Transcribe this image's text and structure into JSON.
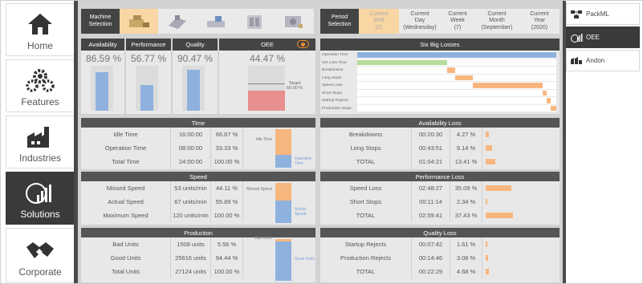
{
  "left_nav": [
    {
      "label": "Home",
      "icon": "home-icon"
    },
    {
      "label": "Features",
      "icon": "gears-icon"
    },
    {
      "label": "Industries",
      "icon": "factory-icon"
    },
    {
      "label": "Solutions",
      "icon": "solutions-icon"
    },
    {
      "label": "Corporate",
      "icon": "handshake-icon"
    }
  ],
  "right_nav": [
    {
      "label": "PackML",
      "icon": "packml-icon"
    },
    {
      "label": "OEE",
      "icon": "oee-icon"
    },
    {
      "label": "Andon",
      "icon": "andon-icon"
    }
  ],
  "machine_selection": {
    "label": "Machine Selection",
    "machines": [
      "machine-1-icon",
      "machine-2-icon",
      "machine-3-icon",
      "machine-4-icon",
      "machine-5-icon",
      "machine-6-icon"
    ]
  },
  "period_selection": {
    "label": "Period Selection",
    "periods": [
      {
        "line1": "Current",
        "line2": "Shift",
        "line3": "(2)"
      },
      {
        "line1": "Current",
        "line2": "Day",
        "line3": "(Wednesday)"
      },
      {
        "line1": "Current",
        "line2": "Week",
        "line3": "(7)"
      },
      {
        "line1": "Current",
        "line2": "Month",
        "line3": "(September)"
      },
      {
        "line1": "Current",
        "line2": "Year",
        "line3": "(2020)"
      }
    ]
  },
  "kpis": [
    {
      "label": "Availability",
      "value": "86.59 %",
      "level": 0.8659
    },
    {
      "label": "Performance",
      "value": "56.77 %",
      "level": 0.5677
    },
    {
      "label": "Quality",
      "value": "90.47 %",
      "level": 0.9047
    }
  ],
  "oee": {
    "label": "OEE",
    "value": "44.47 %",
    "level": 0.4447,
    "target_label": "Target",
    "target_value": "60.00 %",
    "target_level": 0.6
  },
  "six_big_losses": {
    "title": "Six Big Losses",
    "chart_data": {
      "type": "bar",
      "categories": [
        "Operation Time",
        "Net Loss Time",
        "Breakdowns",
        "Long Stops",
        "Speed Loss",
        "Short Stops",
        "Startup Rejects",
        "Production Stops"
      ],
      "values": [
        1,
        0.45,
        0.04,
        0.09,
        0.35,
        0.02,
        0.02,
        0.04
      ],
      "offsets": [
        0,
        0,
        0.45,
        0.49,
        0.58,
        0.93,
        0.95,
        0.97
      ]
    }
  },
  "time": {
    "title": "Time",
    "rows": [
      {
        "label": "Idle Time",
        "value": "16:00:00",
        "pct": "66.67 %"
      },
      {
        "label": "Operation Time",
        "value": "08:00:00",
        "pct": "33.33 %"
      },
      {
        "label": "Total Time",
        "value": "24:00:00",
        "pct": "100.00 %"
      }
    ],
    "chart": {
      "top_label": "Idle Time",
      "bottom_label": "Operation Time",
      "top_level": 0.6667
    }
  },
  "speed": {
    "title": "Speed",
    "rows": [
      {
        "label": "Missed Speed",
        "value": "53 units/min",
        "pct": "44.11 %"
      },
      {
        "label": "Actual Speed",
        "value": "67 units/min",
        "pct": "55.89 %"
      },
      {
        "label": "Maximum Speed",
        "value": "120 units/min",
        "pct": "100.00 %"
      }
    ],
    "chart": {
      "top_label": "Missed Speed",
      "bottom_label": "Actual Speed",
      "top_level": 0.4411
    }
  },
  "production": {
    "title": "Production",
    "rows": [
      {
        "label": "Bad Units",
        "value": "1508 units",
        "pct": "5.56 %"
      },
      {
        "label": "Good Units",
        "value": "25616 units",
        "pct": "94.44 %"
      },
      {
        "label": "Total Units",
        "value": "27124 units",
        "pct": "100.00 %"
      }
    ],
    "chart": {
      "top_label": "Bad Units",
      "bottom_label": "Good Units",
      "top_level": 0.0556
    }
  },
  "availability_loss": {
    "title": "Availability Loss",
    "rows": [
      {
        "label": "Breakdowns",
        "value": "00:20:30",
        "pct": "4.27 %",
        "level": 0.0427
      },
      {
        "label": "Long Stops",
        "value": "00:43:51",
        "pct": "9.14 %",
        "level": 0.0914
      },
      {
        "label": "TOTAL",
        "value": "01:04:21",
        "pct": "13.41 %",
        "level": 0.1341
      }
    ]
  },
  "performance_loss": {
    "title": "Performance Loss",
    "rows": [
      {
        "label": "Speed Loss",
        "value": "02:48:27",
        "pct": "35.09 %",
        "level": 0.3509
      },
      {
        "label": "Short Stops",
        "value": "00:11:14",
        "pct": "2.34 %",
        "level": 0.0234
      },
      {
        "label": "TOTAL",
        "value": "02:59:41",
        "pct": "37.43 %",
        "level": 0.3743
      }
    ]
  },
  "quality_loss": {
    "title": "Quality Loss",
    "rows": [
      {
        "label": "Startup Rejects",
        "value": "00:07:42",
        "pct": "1.61 %",
        "level": 0.0161
      },
      {
        "label": "Production Rejects",
        "value": "00:14:46",
        "pct": "3.08 %",
        "level": 0.0308
      },
      {
        "label": "TOTAL",
        "value": "00:22:29",
        "pct": "4.68 %",
        "level": 0.0468
      }
    ]
  },
  "colors": {
    "accent": "#f8b67f",
    "blue": "#8fb1dd",
    "red": "#e88f8f",
    "green": "#b5dc9a",
    "dark": "#444444"
  }
}
